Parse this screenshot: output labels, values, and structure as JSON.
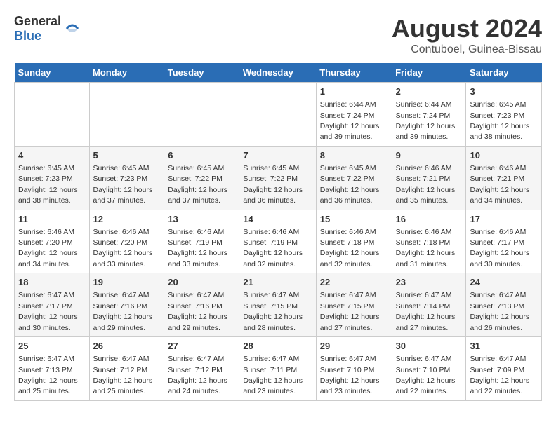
{
  "header": {
    "logo_general": "General",
    "logo_blue": "Blue",
    "title": "August 2024",
    "subtitle": "Contuboel, Guinea-Bissau"
  },
  "days_of_week": [
    "Sunday",
    "Monday",
    "Tuesday",
    "Wednesday",
    "Thursday",
    "Friday",
    "Saturday"
  ],
  "weeks": [
    [
      {
        "day": "",
        "detail": ""
      },
      {
        "day": "",
        "detail": ""
      },
      {
        "day": "",
        "detail": ""
      },
      {
        "day": "",
        "detail": ""
      },
      {
        "day": "1",
        "detail": "Sunrise: 6:44 AM\nSunset: 7:24 PM\nDaylight: 12 hours\nand 39 minutes."
      },
      {
        "day": "2",
        "detail": "Sunrise: 6:44 AM\nSunset: 7:24 PM\nDaylight: 12 hours\nand 39 minutes."
      },
      {
        "day": "3",
        "detail": "Sunrise: 6:45 AM\nSunset: 7:23 PM\nDaylight: 12 hours\nand 38 minutes."
      }
    ],
    [
      {
        "day": "4",
        "detail": "Sunrise: 6:45 AM\nSunset: 7:23 PM\nDaylight: 12 hours\nand 38 minutes."
      },
      {
        "day": "5",
        "detail": "Sunrise: 6:45 AM\nSunset: 7:23 PM\nDaylight: 12 hours\nand 37 minutes."
      },
      {
        "day": "6",
        "detail": "Sunrise: 6:45 AM\nSunset: 7:22 PM\nDaylight: 12 hours\nand 37 minutes."
      },
      {
        "day": "7",
        "detail": "Sunrise: 6:45 AM\nSunset: 7:22 PM\nDaylight: 12 hours\nand 36 minutes."
      },
      {
        "day": "8",
        "detail": "Sunrise: 6:45 AM\nSunset: 7:22 PM\nDaylight: 12 hours\nand 36 minutes."
      },
      {
        "day": "9",
        "detail": "Sunrise: 6:46 AM\nSunset: 7:21 PM\nDaylight: 12 hours\nand 35 minutes."
      },
      {
        "day": "10",
        "detail": "Sunrise: 6:46 AM\nSunset: 7:21 PM\nDaylight: 12 hours\nand 34 minutes."
      }
    ],
    [
      {
        "day": "11",
        "detail": "Sunrise: 6:46 AM\nSunset: 7:20 PM\nDaylight: 12 hours\nand 34 minutes."
      },
      {
        "day": "12",
        "detail": "Sunrise: 6:46 AM\nSunset: 7:20 PM\nDaylight: 12 hours\nand 33 minutes."
      },
      {
        "day": "13",
        "detail": "Sunrise: 6:46 AM\nSunset: 7:19 PM\nDaylight: 12 hours\nand 33 minutes."
      },
      {
        "day": "14",
        "detail": "Sunrise: 6:46 AM\nSunset: 7:19 PM\nDaylight: 12 hours\nand 32 minutes."
      },
      {
        "day": "15",
        "detail": "Sunrise: 6:46 AM\nSunset: 7:18 PM\nDaylight: 12 hours\nand 32 minutes."
      },
      {
        "day": "16",
        "detail": "Sunrise: 6:46 AM\nSunset: 7:18 PM\nDaylight: 12 hours\nand 31 minutes."
      },
      {
        "day": "17",
        "detail": "Sunrise: 6:46 AM\nSunset: 7:17 PM\nDaylight: 12 hours\nand 30 minutes."
      }
    ],
    [
      {
        "day": "18",
        "detail": "Sunrise: 6:47 AM\nSunset: 7:17 PM\nDaylight: 12 hours\nand 30 minutes."
      },
      {
        "day": "19",
        "detail": "Sunrise: 6:47 AM\nSunset: 7:16 PM\nDaylight: 12 hours\nand 29 minutes."
      },
      {
        "day": "20",
        "detail": "Sunrise: 6:47 AM\nSunset: 7:16 PM\nDaylight: 12 hours\nand 29 minutes."
      },
      {
        "day": "21",
        "detail": "Sunrise: 6:47 AM\nSunset: 7:15 PM\nDaylight: 12 hours\nand 28 minutes."
      },
      {
        "day": "22",
        "detail": "Sunrise: 6:47 AM\nSunset: 7:15 PM\nDaylight: 12 hours\nand 27 minutes."
      },
      {
        "day": "23",
        "detail": "Sunrise: 6:47 AM\nSunset: 7:14 PM\nDaylight: 12 hours\nand 27 minutes."
      },
      {
        "day": "24",
        "detail": "Sunrise: 6:47 AM\nSunset: 7:13 PM\nDaylight: 12 hours\nand 26 minutes."
      }
    ],
    [
      {
        "day": "25",
        "detail": "Sunrise: 6:47 AM\nSunset: 7:13 PM\nDaylight: 12 hours\nand 25 minutes."
      },
      {
        "day": "26",
        "detail": "Sunrise: 6:47 AM\nSunset: 7:12 PM\nDaylight: 12 hours\nand 25 minutes."
      },
      {
        "day": "27",
        "detail": "Sunrise: 6:47 AM\nSunset: 7:12 PM\nDaylight: 12 hours\nand 24 minutes."
      },
      {
        "day": "28",
        "detail": "Sunrise: 6:47 AM\nSunset: 7:11 PM\nDaylight: 12 hours\nand 23 minutes."
      },
      {
        "day": "29",
        "detail": "Sunrise: 6:47 AM\nSunset: 7:10 PM\nDaylight: 12 hours\nand 23 minutes."
      },
      {
        "day": "30",
        "detail": "Sunrise: 6:47 AM\nSunset: 7:10 PM\nDaylight: 12 hours\nand 22 minutes."
      },
      {
        "day": "31",
        "detail": "Sunrise: 6:47 AM\nSunset: 7:09 PM\nDaylight: 12 hours\nand 22 minutes."
      }
    ]
  ]
}
